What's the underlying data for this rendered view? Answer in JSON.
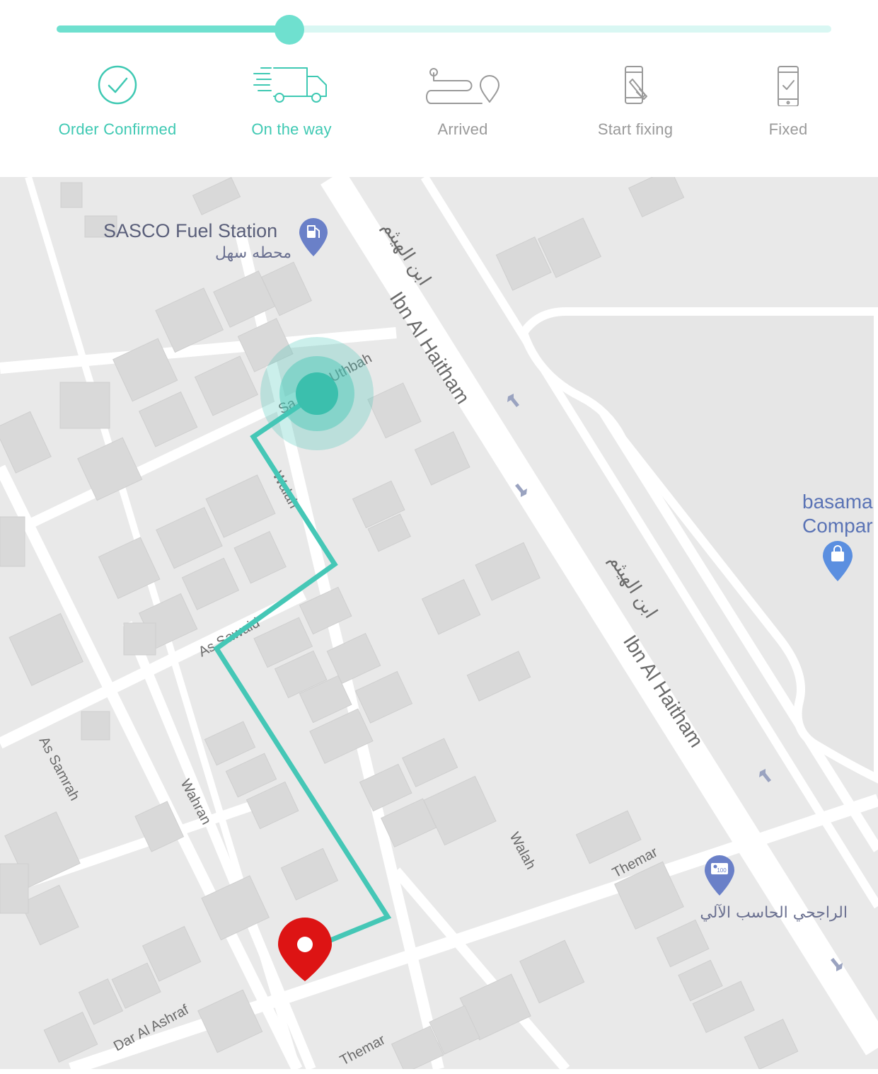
{
  "tracker": {
    "progress_percent": 30,
    "steps": [
      {
        "label": "Order Confirmed",
        "icon": "check-circle-icon",
        "state": "active"
      },
      {
        "label": "On the way",
        "icon": "delivery-truck-icon",
        "state": "active"
      },
      {
        "label": "Arrived",
        "icon": "route-pin-icon",
        "state": "inactive"
      },
      {
        "label": "Start fixing",
        "icon": "phone-repair-icon",
        "state": "inactive"
      },
      {
        "label": "Fixed",
        "icon": "phone-check-icon",
        "state": "inactive"
      }
    ]
  },
  "map": {
    "places": {
      "fuel_station_en": "SASCO Fuel Station",
      "fuel_station_ar": "محطه سهل",
      "company_line1": "basama",
      "company_line2": "Compar",
      "atm_ar": "الراجحي الحاسب الآلي"
    },
    "streets": {
      "ibn_haitham_ar_1": "ابن الهيثم",
      "ibn_haitham_en_1": "Ibn Al Haitham",
      "ibn_haitham_ar_2": "ابن الهيثم",
      "ibn_haitham_en_2": "Ibn Al Haitham",
      "uthbah": "Uthbah",
      "sa": "Sa",
      "walah_1": "Walah",
      "walah_2": "Walah",
      "as_sawaid": "As Sawaid",
      "as_samrah": "As Samrah",
      "wahran": "Wahran",
      "themar_1": "Themar",
      "themar_2": "Themar",
      "dar_al_ashraf": "Dar Al Ashraf"
    },
    "colors": {
      "route": "#45c7b6",
      "destination_pin": "#dd1414",
      "place_pin": "#6a80c8",
      "accent": "#6fe0cf"
    }
  }
}
